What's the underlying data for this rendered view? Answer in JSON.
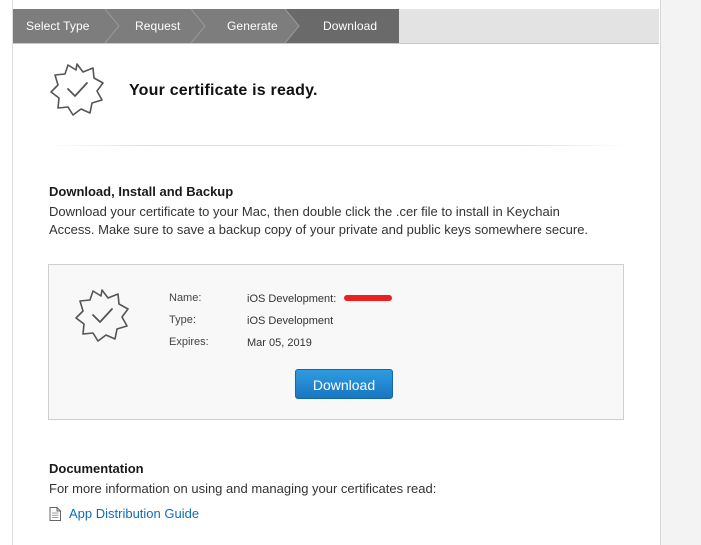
{
  "steps": [
    {
      "label": "Select Type",
      "state": "completed"
    },
    {
      "label": "Request",
      "state": "completed"
    },
    {
      "label": "Generate",
      "state": "completed"
    },
    {
      "label": "Download",
      "state": "current"
    }
  ],
  "header": {
    "title": "Your certificate is ready.",
    "icon": "certificate-badge-icon"
  },
  "download_section": {
    "title": "Download, Install and Backup",
    "description_line1": "Download your certificate to your Mac, then double click the .cer file to install in Keychain",
    "description_line2": "Access. Make sure to save a backup copy of your private and public keys somewhere secure."
  },
  "certificate": {
    "name_label": "Name:",
    "name_value": "iOS Development:",
    "type_label": "Type:",
    "type_value": "iOS Development",
    "expires_label": "Expires:",
    "expires_value": "Mar 05, 2019",
    "download_label": "Download"
  },
  "documentation": {
    "title": "Documentation",
    "description": "For more information on using and managing your certificates read:",
    "link_label": "App Distribution Guide"
  },
  "colors": {
    "step_completed": "#7d7d7d",
    "step_current": "#6a6a6a",
    "button": "#1d84cf",
    "link": "#0d6dbb",
    "redaction": "#ee1f1f"
  }
}
